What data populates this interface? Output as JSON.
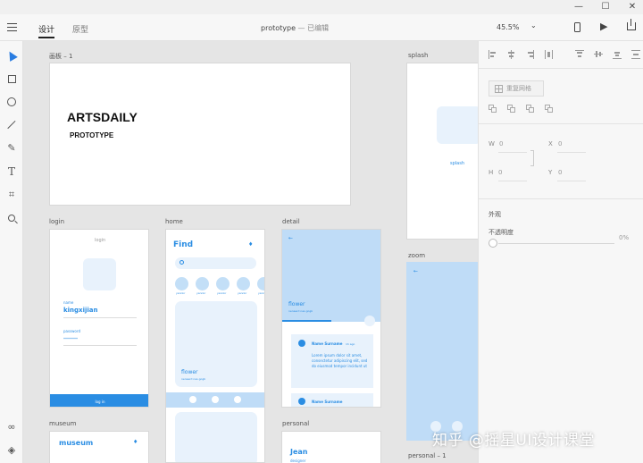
{
  "window": {
    "minimize": "—",
    "maximize": "☐",
    "close": "✕"
  },
  "toolbar": {
    "tab_design": "设计",
    "tab_prototype": "原型",
    "doc_name": "prototype",
    "doc_separator": "—",
    "doc_status": "已编辑",
    "zoom": "45.5%",
    "zoom_caret": "⌄",
    "play": "▶"
  },
  "tools": [
    "select",
    "rectangle",
    "ellipse",
    "line",
    "pen",
    "text",
    "artboard",
    "zoom",
    "plugins",
    "layers"
  ],
  "artboards": {
    "board1": {
      "label": "画板 – 1",
      "title": "ARTSDAILY",
      "subtitle": "PROTOTYPE"
    },
    "splash": {
      "label": "splash",
      "brand": "splash"
    },
    "login": {
      "label": "login",
      "title": "login",
      "name_label": "name",
      "name_value": "kingxijian",
      "pw_label": "password",
      "pw_value": "********",
      "button": "log in"
    },
    "home": {
      "label": "home",
      "title": "Find",
      "card_title": "flower",
      "card_sub": "nenaerd nas gogb",
      "chips": [
        "yannkr",
        "yannkr",
        "yannkr",
        "yannkr",
        "yannkr"
      ]
    },
    "detail": {
      "label": "detail",
      "title": "flower",
      "sub": "nenaerd nas gogb",
      "author": "Name Surname",
      "time": "1h ago",
      "body": "Lorem ipsum dolor sit amet, consectetur adipiscing elit, sed do eiusmod tempor incidunt ut",
      "author2": "Name Surname"
    },
    "zoom": {
      "label": "zoom"
    },
    "museum": {
      "label": "museum",
      "title": "museum"
    },
    "personal": {
      "label": "personal",
      "name": "Jean",
      "role": "designer"
    },
    "personal1": {
      "label": "personal – 1"
    }
  },
  "panel": {
    "repeat_grid": "重复网格",
    "w_label": "W",
    "w_value": "0",
    "h_label": "H",
    "h_value": "0",
    "x_label": "X",
    "x_value": "0",
    "y_label": "Y",
    "y_value": "0",
    "appearance": "外观",
    "opacity_label": "不透明度",
    "opacity_value": "0%"
  },
  "watermark": "知乎 @摇星UI设计课堂",
  "colors": {
    "accent": "#2a8de3",
    "light_blue": "#bfdcf7",
    "canvas": "#e5e5e5"
  }
}
